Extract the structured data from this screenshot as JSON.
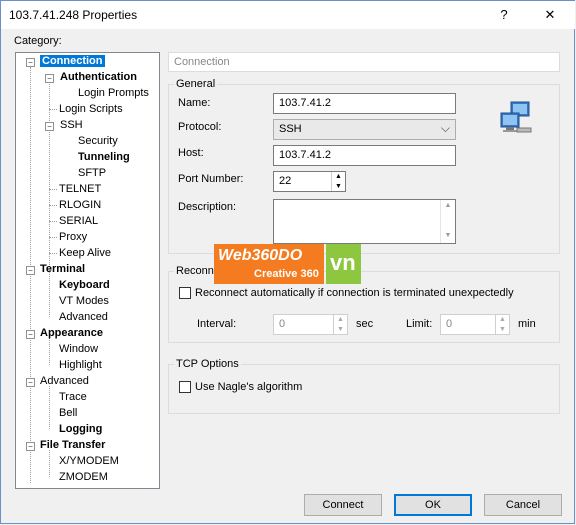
{
  "window": {
    "title": "103.7.41.248 Properties",
    "help_glyph": "?",
    "close_glyph": "✕"
  },
  "category_label": "Category:",
  "tree": {
    "connection": "Connection",
    "authentication": "Authentication",
    "login_prompts": "Login Prompts",
    "login_scripts": "Login Scripts",
    "ssh": "SSH",
    "security": "Security",
    "tunneling": "Tunneling",
    "sftp": "SFTP",
    "telnet": "TELNET",
    "rlogin": "RLOGIN",
    "serial": "SERIAL",
    "proxy": "Proxy",
    "keep_alive": "Keep Alive",
    "terminal": "Terminal",
    "keyboard": "Keyboard",
    "vt_modes": "VT Modes",
    "advanced_terminal": "Advanced",
    "appearance": "Appearance",
    "window": "Window",
    "highlight": "Highlight",
    "advanced": "Advanced",
    "trace": "Trace",
    "bell": "Bell",
    "logging": "Logging",
    "file_transfer": "File Transfer",
    "xymodem": "X/YMODEM",
    "zmodem": "ZMODEM",
    "minus": "−"
  },
  "panel": {
    "title": "Connection",
    "general": {
      "label": "General",
      "name_label": "Name:",
      "name_value": "103.7.41.2",
      "protocol_label": "Protocol:",
      "protocol_value": "SSH",
      "host_label": "Host:",
      "host_value": "103.7.41.2",
      "port_label": "Port Number:",
      "port_value": "22",
      "description_label": "Description:"
    },
    "reconnect": {
      "label": "Reconnect",
      "checkbox_label": "Reconnect automatically if connection is terminated unexpectedly",
      "interval_label": "Interval:",
      "interval_value": "0",
      "interval_unit": "sec",
      "limit_label": "Limit:",
      "limit_value": "0",
      "limit_unit": "min"
    },
    "tcp": {
      "label": "TCP Options",
      "nagle_label": "Use Nagle's algorithm"
    }
  },
  "buttons": {
    "connect": "Connect",
    "ok": "OK",
    "cancel": "Cancel"
  },
  "watermark": {
    "brand": "Web360DO",
    "sub": "Creative 360",
    "vn": "VN"
  },
  "icons": {
    "spin_up": "▲",
    "spin_down": "▼",
    "dropdown": "⌵"
  }
}
